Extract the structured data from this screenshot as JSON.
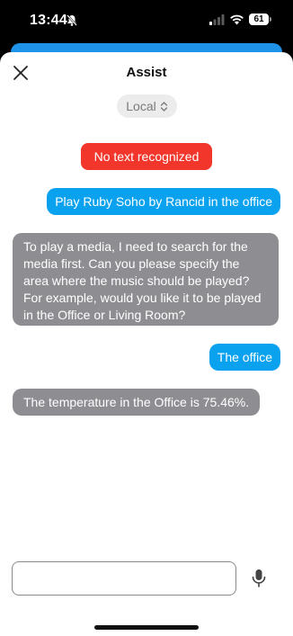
{
  "status_bar": {
    "time": "13:44",
    "battery": "61"
  },
  "dialog": {
    "title": "Assist",
    "pipeline_label": "Local",
    "error_message": "No text recognized"
  },
  "messages": [
    {
      "from": "user",
      "text": "Play Ruby Soho by Rancid in the office"
    },
    {
      "from": "bot",
      "text": "To play a media, I need to search for the media first. Can you please specify the area where the music should be played? For example, would you like it to be played in the Office or Living Room?"
    },
    {
      "from": "user",
      "text": "The office"
    },
    {
      "from": "bot",
      "text": "The temperature in the Office is 75.46%."
    }
  ],
  "input": {
    "placeholder": "",
    "value": ""
  },
  "colors": {
    "user_bubble": "#0aa2ee",
    "bot_bubble": "#8e8e92",
    "error_bubble": "#f2362b"
  },
  "icons": {
    "close": "close-icon",
    "mic": "microphone-icon",
    "chevron": "chevron-up-down-icon"
  }
}
